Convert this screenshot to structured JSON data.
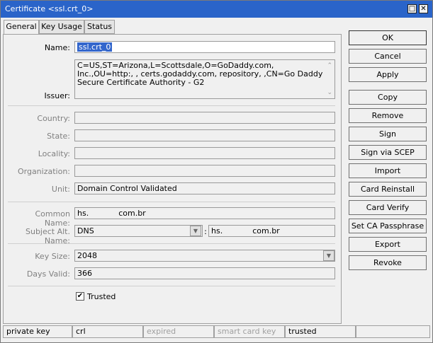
{
  "window": {
    "title": "Certificate <ssl.crt_0>"
  },
  "tabs": [
    {
      "label": "General",
      "active": true
    },
    {
      "label": "Key Usage",
      "active": false
    },
    {
      "label": "Status",
      "active": false
    }
  ],
  "form": {
    "name_label": "Name:",
    "name_value": "ssl.crt_0",
    "issuer_label": "Issuer:",
    "issuer_value": "C=US,ST=Arizona,L=Scottsdale,O=GoDaddy.com, Inc.,OU=http:, , certs.godaddy.com, repository, ,CN=Go Daddy Secure Certificate Authority - G2",
    "country_label": "Country:",
    "state_label": "State:",
    "locality_label": "Locality:",
    "organization_label": "Organization:",
    "unit_label": "Unit:",
    "unit_value": "Domain Control Validated",
    "common_name_label": "Common Name:",
    "common_name_prefix": "hs.",
    "common_name_suffix": "com.br",
    "subject_alt_label": "Subject Alt. Name:",
    "subject_alt_type": "DNS",
    "subject_alt_colon": ":",
    "subject_alt_prefix": "hs.",
    "subject_alt_suffix": "com.br",
    "key_size_label": "Key Size:",
    "key_size_value": "2048",
    "days_valid_label": "Days Valid:",
    "days_valid_value": "366",
    "trusted_label": "Trusted",
    "trusted_checked": true
  },
  "buttons": {
    "ok": "OK",
    "cancel": "Cancel",
    "apply": "Apply",
    "copy": "Copy",
    "remove": "Remove",
    "sign": "Sign",
    "sign_scep": "Sign via SCEP",
    "import": "Import",
    "card_reinstall": "Card Reinstall",
    "card_verify": "Card Verify",
    "set_ca_passphrase": "Set CA Passphrase",
    "export": "Export",
    "revoke": "Revoke"
  },
  "statusbar": {
    "private_key": "private key",
    "crl": "crl",
    "expired": "expired",
    "smart_card_key": "smart card key",
    "trusted": "trusted"
  },
  "colors": {
    "titlebar": "#2a64c9",
    "selection": "#3366cc"
  }
}
